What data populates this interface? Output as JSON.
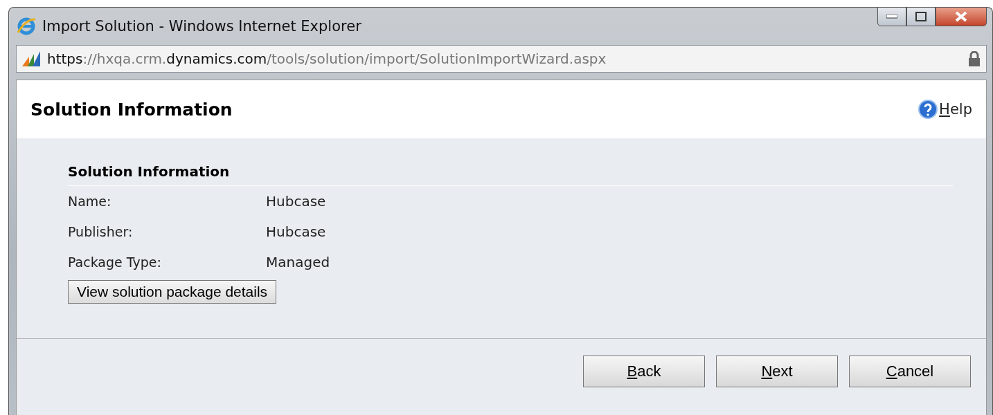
{
  "window": {
    "title": "Import Solution - Windows Internet Explorer"
  },
  "address_bar": {
    "url": [
      {
        "text": "https",
        "emphasis": true
      },
      {
        "text": "://hxqa.crm.",
        "emphasis": false
      },
      {
        "text": "dynamics.com",
        "emphasis": true
      },
      {
        "text": "/tools/solution/import/SolutionImportWizard.aspx",
        "emphasis": false
      }
    ]
  },
  "page": {
    "title": "Solution Information",
    "help": "Help"
  },
  "section": {
    "heading": "Solution Information",
    "fields": [
      {
        "label": "Name:",
        "value": "Hubcase"
      },
      {
        "label": "Publisher:",
        "value": "Hubcase"
      },
      {
        "label": "Package Type:",
        "value": "Managed"
      }
    ],
    "details_button": "View solution package details"
  },
  "buttons": [
    "Back",
    "Next",
    "Cancel"
  ]
}
